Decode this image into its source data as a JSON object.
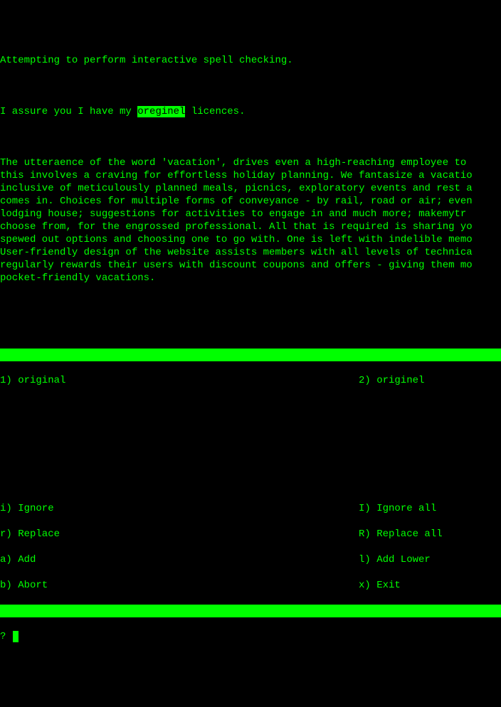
{
  "header": "Attempting to perform interactive spell checking.",
  "line1_pre": "I assure you I have my ",
  "misspelled": "oreginel",
  "line1_post": " licences.",
  "paragraph": "The utteraence of the word 'vacation', drives even a high-reaching employee to\nthis involves a craving for effortless holiday planning. We fantasize a vacatio\ninclusive of meticulously planned meals, picnics, exploratory events and rest a\ncomes in. Choices for multiple forms of conveyance - by rail, road or air; even\nlodging house; suggestions for activities to engage in and much more; makemytr\nchoose from, for the engrossed professional. All that is required is sharing yo\nspewed out options and choosing one to go with. One is left with indelible memo\nUser-friendly design of the website assists members with all levels of technica\nregularly rewards their users with discount coupons and offers - giving them mo\npocket-friendly vacations.",
  "suggestions": {
    "s1": "1) original",
    "s2": "2) originel"
  },
  "commands": {
    "i": "i) Ignore",
    "I": "I) Ignore all",
    "r": "r) Replace",
    "R": "R) Replace all",
    "a": "a) Add",
    "l": "l) Add Lower",
    "b": "b) Abort",
    "x": "x) Exit"
  },
  "prompt": "? "
}
